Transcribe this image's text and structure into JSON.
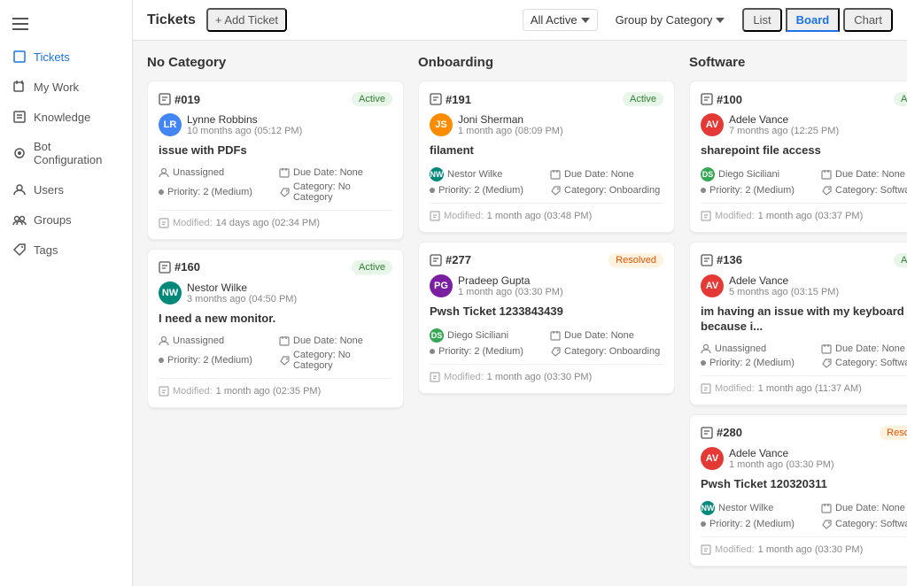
{
  "sidebar": {
    "items": [
      {
        "id": "tickets",
        "label": "Tickets",
        "active": true
      },
      {
        "id": "my-work",
        "label": "My Work",
        "active": false
      },
      {
        "id": "knowledge",
        "label": "Knowledge",
        "active": false
      },
      {
        "id": "bot-config",
        "label": "Bot Configuration",
        "active": false
      },
      {
        "id": "users",
        "label": "Users",
        "active": false
      },
      {
        "id": "groups",
        "label": "Groups",
        "active": false
      },
      {
        "id": "tags",
        "label": "Tags",
        "active": false
      }
    ]
  },
  "header": {
    "title": "Tickets",
    "add_btn": "+ Add Ticket",
    "filter_label": "All Active",
    "group_label": "Group by Category",
    "views": [
      "List",
      "Board",
      "Chart"
    ],
    "active_view": "Board"
  },
  "columns": [
    {
      "id": "no-category",
      "title": "No Category",
      "cards": [
        {
          "id": "#019",
          "badge": "Active",
          "badge_type": "active",
          "user_name": "Lynne Robbins",
          "user_time": "10 months ago (05:12 PM)",
          "user_initials": "LR",
          "user_color": "av-blue",
          "title": "issue with PDFs",
          "assigned": "Unassigned",
          "due_date": "None",
          "priority": "2 (Medium)",
          "category": "No Category",
          "modified": "14 days ago (02:34 PM)"
        },
        {
          "id": "#160",
          "badge": "Active",
          "badge_type": "active",
          "user_name": "Nestor Wilke",
          "user_time": "3 months ago (04:50 PM)",
          "user_initials": "NW",
          "user_color": "av-teal",
          "title": "I need a new monitor.",
          "assigned": "Unassigned",
          "due_date": "None",
          "priority": "2 (Medium)",
          "category": "No Category",
          "modified": "1 month ago (02:35 PM)"
        }
      ]
    },
    {
      "id": "onboarding",
      "title": "Onboarding",
      "cards": [
        {
          "id": "#191",
          "badge": "Active",
          "badge_type": "active",
          "user_name": "Joni Sherman",
          "user_time": "1 month ago (08:09 PM)",
          "user_initials": "JS",
          "user_color": "av-orange",
          "title": "filament",
          "assigned": "Nestor Wilke",
          "assigned_initials": "NW",
          "assigned_color": "av-teal",
          "due_date": "None",
          "priority": "2 (Medium)",
          "category": "Onboarding",
          "modified": "1 month ago (03:48 PM)"
        },
        {
          "id": "#277",
          "badge": "Resolved",
          "badge_type": "resolved",
          "user_name": "Pradeep Gupta",
          "user_time": "1 month ago (03:30 PM)",
          "user_initials": "PG",
          "user_color": "av-purple",
          "title": "Pwsh Ticket 1233843439",
          "assigned": "Diego Siciliani",
          "assigned_initials": "DS",
          "assigned_color": "av-green",
          "due_date": "None",
          "priority": "2 (Medium)",
          "category": "Onboarding",
          "modified": "1 month ago (03:30 PM)"
        }
      ]
    },
    {
      "id": "software",
      "title": "Software",
      "cards": [
        {
          "id": "#100",
          "badge": "Active",
          "badge_type": "active",
          "user_name": "Adele Vance",
          "user_time": "7 months ago (12:25 PM)",
          "user_initials": "AV",
          "user_color": "av-red",
          "title": "sharepoint file access",
          "assigned": "Diego Siciliani",
          "assigned_initials": "DS",
          "assigned_color": "av-green",
          "due_date": "None",
          "priority": "2 (Medium)",
          "category": "Software",
          "modified": "1 month ago (03:37 PM)"
        },
        {
          "id": "#136",
          "badge": "Active",
          "badge_type": "active",
          "user_name": "Adele Vance",
          "user_time": "5 months ago (03:15 PM)",
          "user_initials": "AV",
          "user_color": "av-red",
          "title": "im having an issue with my keyboard because i...",
          "assigned": "Unassigned",
          "due_date": "None",
          "priority": "2 (Medium)",
          "category": "Software",
          "modified": "1 month ago (11:37 AM)"
        },
        {
          "id": "#280",
          "badge": "Resolved",
          "badge_type": "resolved",
          "user_name": "Adele Vance",
          "user_time": "1 month ago (03:30 PM)",
          "user_initials": "AV",
          "user_color": "av-red",
          "title": "Pwsh Ticket 120320311",
          "assigned": "Nestor Wilke",
          "assigned_initials": "NW",
          "assigned_color": "av-teal",
          "due_date": "None",
          "priority": "2 (Medium)",
          "category": "Software",
          "modified": "1 month ago (03:30 PM)"
        }
      ]
    }
  ],
  "labels": {
    "assigned": "Unassigned",
    "due_date_prefix": "Due Date:",
    "priority_prefix": "Priority:",
    "category_prefix": "Category:",
    "modified_prefix": "Modified:"
  }
}
